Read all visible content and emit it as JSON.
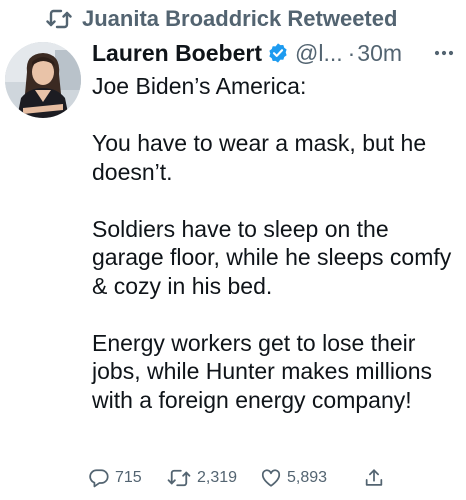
{
  "social_context": {
    "text": "Juanita Broaddrick Retweeted"
  },
  "author": {
    "name": "Lauren Boebert",
    "handle": "@l...",
    "separator": "·",
    "time": "30m"
  },
  "tweet": {
    "paragraphs": [
      "Joe Biden’s America:",
      "You have to wear a mask, but he doesn’t.",
      "Soldiers have to sleep on the garage floor, while he sleeps comfy & cozy in his bed.",
      "Energy workers get to lose their jobs, while Hunter makes millions with a foreign energy company!"
    ]
  },
  "actions": {
    "replies": "715",
    "retweets": "2,319",
    "likes": "5,893"
  },
  "colors": {
    "text": "#0f1419",
    "muted": "#536471",
    "verified": "#1d9bf0"
  },
  "icons": {
    "retweeted": "retweet-icon",
    "verified": "verified-badge-icon",
    "more": "more-horizontal-icon",
    "reply": "reply-icon",
    "retweet": "retweet-icon",
    "like": "heart-icon",
    "share": "share-icon"
  }
}
